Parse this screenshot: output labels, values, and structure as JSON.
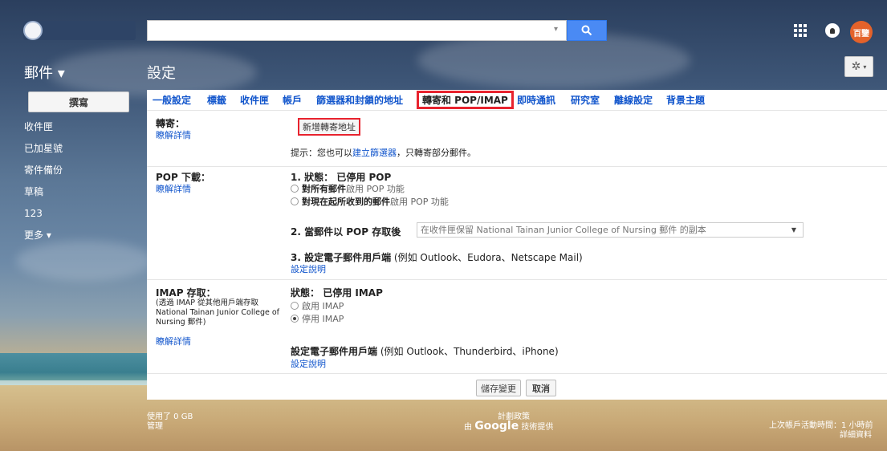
{
  "header": {
    "search_placeholder": "",
    "avatar_text": "百鑒"
  },
  "bar": {
    "mail_menu": "郵件 ▾",
    "page_title": "設定"
  },
  "nav": {
    "compose": "撰寫",
    "items": [
      {
        "label": "收件匣"
      },
      {
        "label": "已加星號"
      },
      {
        "label": "寄件備份"
      },
      {
        "label": "草稿"
      },
      {
        "label": "123"
      },
      {
        "label": "更多 ▾"
      }
    ]
  },
  "tabs": [
    {
      "label": "一般設定"
    },
    {
      "label": "標籤"
    },
    {
      "label": "收件匣"
    },
    {
      "label": "帳戶"
    },
    {
      "label": "篩選器和封鎖的地址"
    },
    {
      "label": "轉寄和 POP/IMAP"
    },
    {
      "label": "即時通訊"
    },
    {
      "label": "研究室"
    },
    {
      "label": "離線設定"
    },
    {
      "label": "背景主題"
    }
  ],
  "forwarding": {
    "label": "轉寄：",
    "learn_more": "瞭解詳情",
    "add_button": "新增轉寄地址",
    "tip_prefix": "提示：您也可以",
    "tip_link": "建立篩選器",
    "tip_suffix": "，只轉寄部分郵件。"
  },
  "pop": {
    "label": "POP 下載：",
    "learn_more": "瞭解詳情",
    "status_num": "1.",
    "status_label": "狀態：",
    "status_value": "已停用 POP",
    "opt1_bold": "對所有郵件",
    "opt1_rest": "啟用 POP 功能",
    "opt2_bold": "對現在起所收到的郵件",
    "opt2_rest": "啟用 POP 功能",
    "after_label": "2. 當郵件以 POP 存取後",
    "after_select": "在收件匣保留 National Tainan Junior College of Nursing 郵件 的副本",
    "client_bold": "3. 設定電子郵件用戶端",
    "client_rest": "(例如 Outlook、Eudora、Netscape Mail)",
    "setup_link": "設定說明"
  },
  "imap": {
    "label": "IMAP 存取：",
    "desc": "(透過 IMAP 從其他用戶端存取 National Tainan Junior College of Nursing 郵件)",
    "learn_more": "瞭解詳情",
    "status_label": "狀態：",
    "status_value": "已停用 IMAP",
    "opt_enable": "啟用 IMAP",
    "opt_disable": "停用 IMAP",
    "client_bold": "設定電子郵件用戶端",
    "client_rest": "(例如 Outlook、Thunderbird、iPhone)",
    "setup_link": "設定說明"
  },
  "actions": {
    "save": "儲存變更",
    "cancel": "取消"
  },
  "footer": {
    "usage": "使用了 0 GB",
    "manage": "管理",
    "policy": "計劃政策",
    "powered_prefix": "由",
    "powered_brand": "Google",
    "powered_suffix": "技術提供",
    "last_activity": "上次帳戶活動時間：1 小時前",
    "details": "詳細資料"
  },
  "colors": {
    "accent_blue": "#4a8af4",
    "link": "#1155cc",
    "highlight_red": "#e8232e",
    "avatar": "#e4622a"
  }
}
